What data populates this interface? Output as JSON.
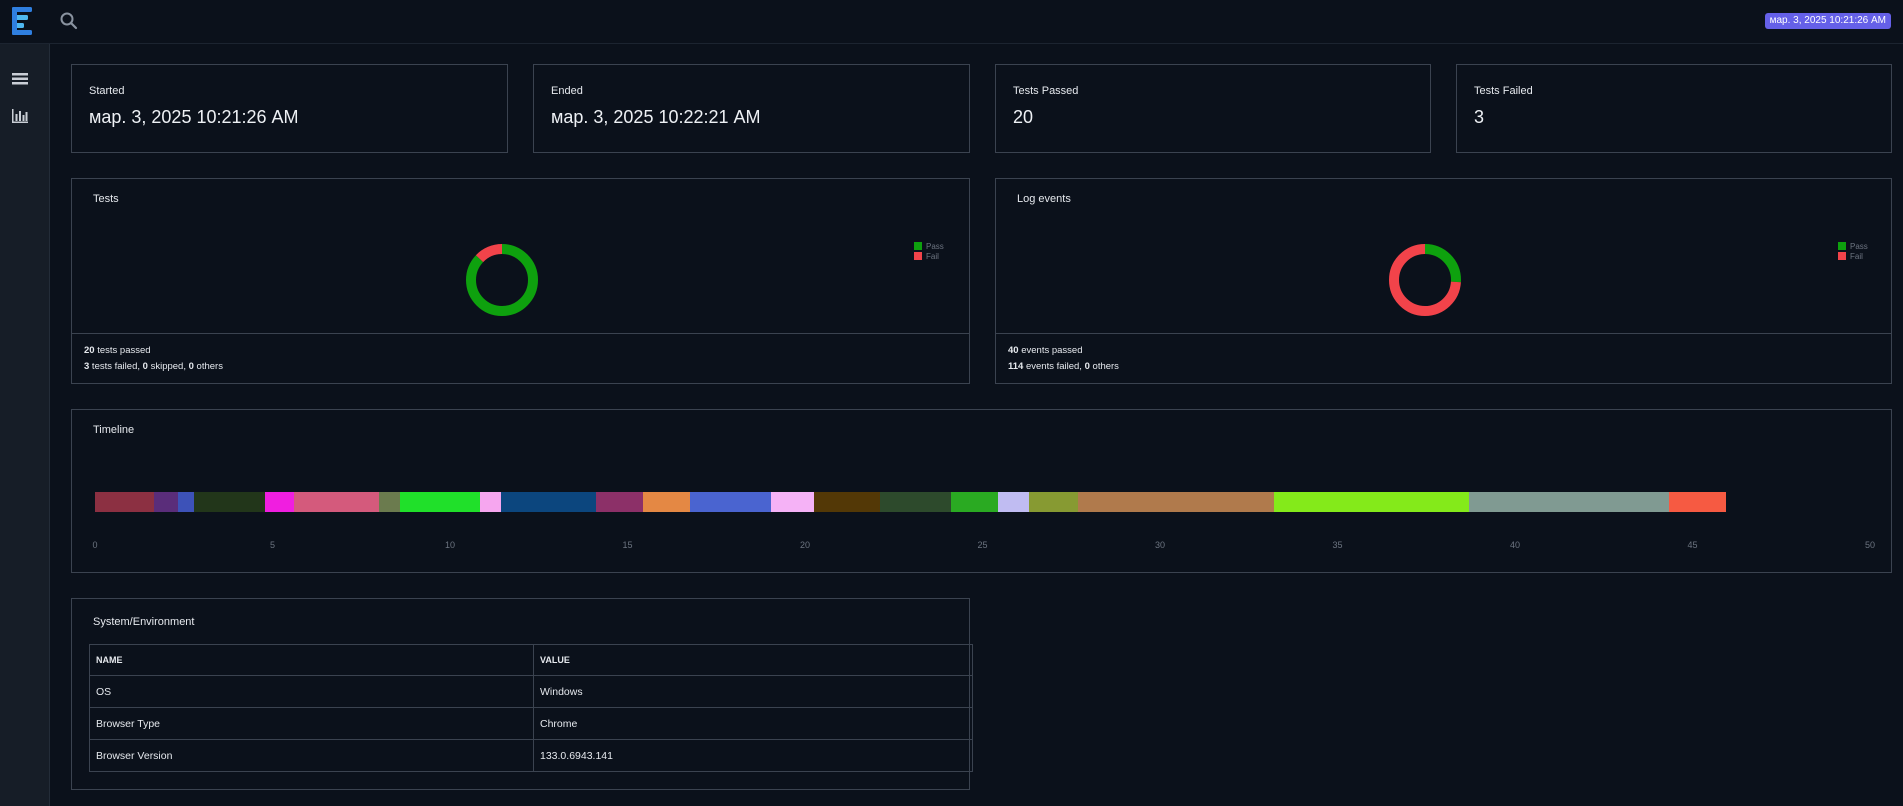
{
  "header": {
    "date_badge": "мар. 3, 2025 10:21:26 AM",
    "icons": [
      "logo-icon",
      "search-icon"
    ]
  },
  "sidebar": {
    "items": [
      {
        "icon": "list-icon"
      },
      {
        "icon": "bar-chart-icon"
      }
    ]
  },
  "stats": [
    {
      "label": "Started",
      "value": "мар. 3, 2025 10:21:26 AM"
    },
    {
      "label": "Ended",
      "value": "мар. 3, 2025 10:22:21 AM"
    },
    {
      "label": "Tests Passed",
      "value": "20"
    },
    {
      "label": "Tests Failed",
      "value": "3"
    }
  ],
  "tests_panel": {
    "title": "Tests",
    "legend": [
      "Pass",
      "Fail"
    ],
    "footer": {
      "passed_count": "20",
      "passed_text": " tests passed",
      "failed_count": "3",
      "failed_text": " tests failed, ",
      "skipped_count": "0",
      "skipped_text": " skipped, ",
      "others_count": "0",
      "others_text": " others"
    }
  },
  "log_panel": {
    "title": "Log events",
    "legend": [
      "Pass",
      "Fail"
    ],
    "footer": {
      "passed_count": "40",
      "passed_text": " events passed",
      "failed_count": "114",
      "failed_text": " events failed, ",
      "others_count": "0",
      "others_text": " others"
    }
  },
  "colors": {
    "pass": "#0ea10e",
    "fail": "#f2434a",
    "badge": "#6560e8"
  },
  "timeline": {
    "title": "Timeline",
    "axis_ticks": [
      0,
      5,
      10,
      15,
      20,
      25,
      30,
      35,
      40,
      45,
      50
    ],
    "segments": [
      {
        "start": 0,
        "end": 1.65,
        "color": "#8c3042"
      },
      {
        "start": 1.65,
        "end": 2.35,
        "color": "#5a2d7a"
      },
      {
        "start": 2.35,
        "end": 2.8,
        "color": "#3d52b8"
      },
      {
        "start": 2.8,
        "end": 4.8,
        "color": "#22361a"
      },
      {
        "start": 4.8,
        "end": 5.6,
        "color": "#f01ee0"
      },
      {
        "start": 5.6,
        "end": 8.0,
        "color": "#d45a7c"
      },
      {
        "start": 8.0,
        "end": 8.6,
        "color": "#6b7b4e"
      },
      {
        "start": 8.6,
        "end": 10.85,
        "color": "#20e02a"
      },
      {
        "start": 10.85,
        "end": 11.45,
        "color": "#f6a6ef"
      },
      {
        "start": 11.45,
        "end": 14.1,
        "color": "#0c467e"
      },
      {
        "start": 14.1,
        "end": 15.45,
        "color": "#8c3068"
      },
      {
        "start": 15.45,
        "end": 16.75,
        "color": "#e48844"
      },
      {
        "start": 16.75,
        "end": 19.05,
        "color": "#4a64d0"
      },
      {
        "start": 19.05,
        "end": 20.25,
        "color": "#f5b2f6"
      },
      {
        "start": 20.25,
        "end": 22.1,
        "color": "#533806"
      },
      {
        "start": 22.1,
        "end": 24.1,
        "color": "#2d4a2c"
      },
      {
        "start": 24.1,
        "end": 25.45,
        "color": "#2aaa22"
      },
      {
        "start": 25.45,
        "end": 26.3,
        "color": "#c0bcf2"
      },
      {
        "start": 26.3,
        "end": 27.7,
        "color": "#879a32"
      },
      {
        "start": 27.7,
        "end": 33.2,
        "color": "#b07a4c"
      },
      {
        "start": 33.2,
        "end": 38.7,
        "color": "#84ea1a"
      },
      {
        "start": 38.7,
        "end": 44.35,
        "color": "#809a92"
      },
      {
        "start": 44.35,
        "end": 45.95,
        "color": "#f65a42"
      }
    ]
  },
  "environment": {
    "title": "System/Environment",
    "columns": [
      "NAME",
      "VALUE"
    ],
    "rows": [
      [
        "OS",
        "Windows"
      ],
      [
        "Browser Type",
        "Chrome"
      ],
      [
        "Browser Version",
        "133.0.6943.141"
      ]
    ]
  }
}
